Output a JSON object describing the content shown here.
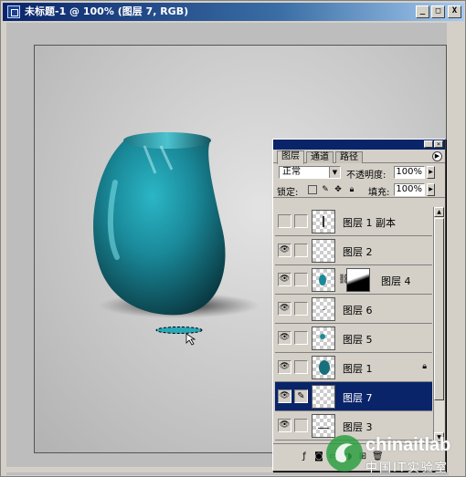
{
  "window": {
    "title": "未标题-1 @ 100% (图层 7, RGB)",
    "buttons": {
      "minimize": "_",
      "maximize": "□",
      "close": "X"
    }
  },
  "palette": {
    "tabs": [
      {
        "label": "图层",
        "active": true
      },
      {
        "label": "通道",
        "active": false
      },
      {
        "label": "路径",
        "active": false
      }
    ],
    "blend_mode": "正常",
    "opacity_label": "不透明度:",
    "opacity_value": "100%",
    "lock_label": "锁定:",
    "fill_label": "填充:",
    "fill_value": "100%",
    "layers": [
      {
        "name": "图层 1 副本",
        "visible": false,
        "selected": false,
        "locked": false,
        "has_mask": false,
        "thumb": "line"
      },
      {
        "name": "图层 2",
        "visible": true,
        "selected": false,
        "locked": false,
        "has_mask": false,
        "thumb": "empty"
      },
      {
        "name": "图层 4",
        "visible": true,
        "selected": false,
        "locked": false,
        "has_mask": true,
        "thumb": "small-dot"
      },
      {
        "name": "图层 6",
        "visible": true,
        "selected": false,
        "locked": false,
        "has_mask": false,
        "thumb": "tiny"
      },
      {
        "name": "图层 5",
        "visible": true,
        "selected": false,
        "locked": false,
        "has_mask": false,
        "thumb": "small-dot"
      },
      {
        "name": "图层 1",
        "visible": true,
        "selected": false,
        "locked": true,
        "has_mask": false,
        "thumb": "vase"
      },
      {
        "name": "图层 7",
        "visible": true,
        "selected": true,
        "locked": false,
        "has_mask": false,
        "thumb": "empty"
      },
      {
        "name": "图层 3",
        "visible": true,
        "selected": false,
        "locked": false,
        "has_mask": false,
        "thumb": "line"
      }
    ]
  },
  "colors": {
    "titlebar": "#0a246a",
    "vase": "#1a8a9a",
    "selected_row": "#0a246a"
  },
  "watermark": {
    "text": "chinaitlab",
    "sub": "中国IT实验室"
  }
}
